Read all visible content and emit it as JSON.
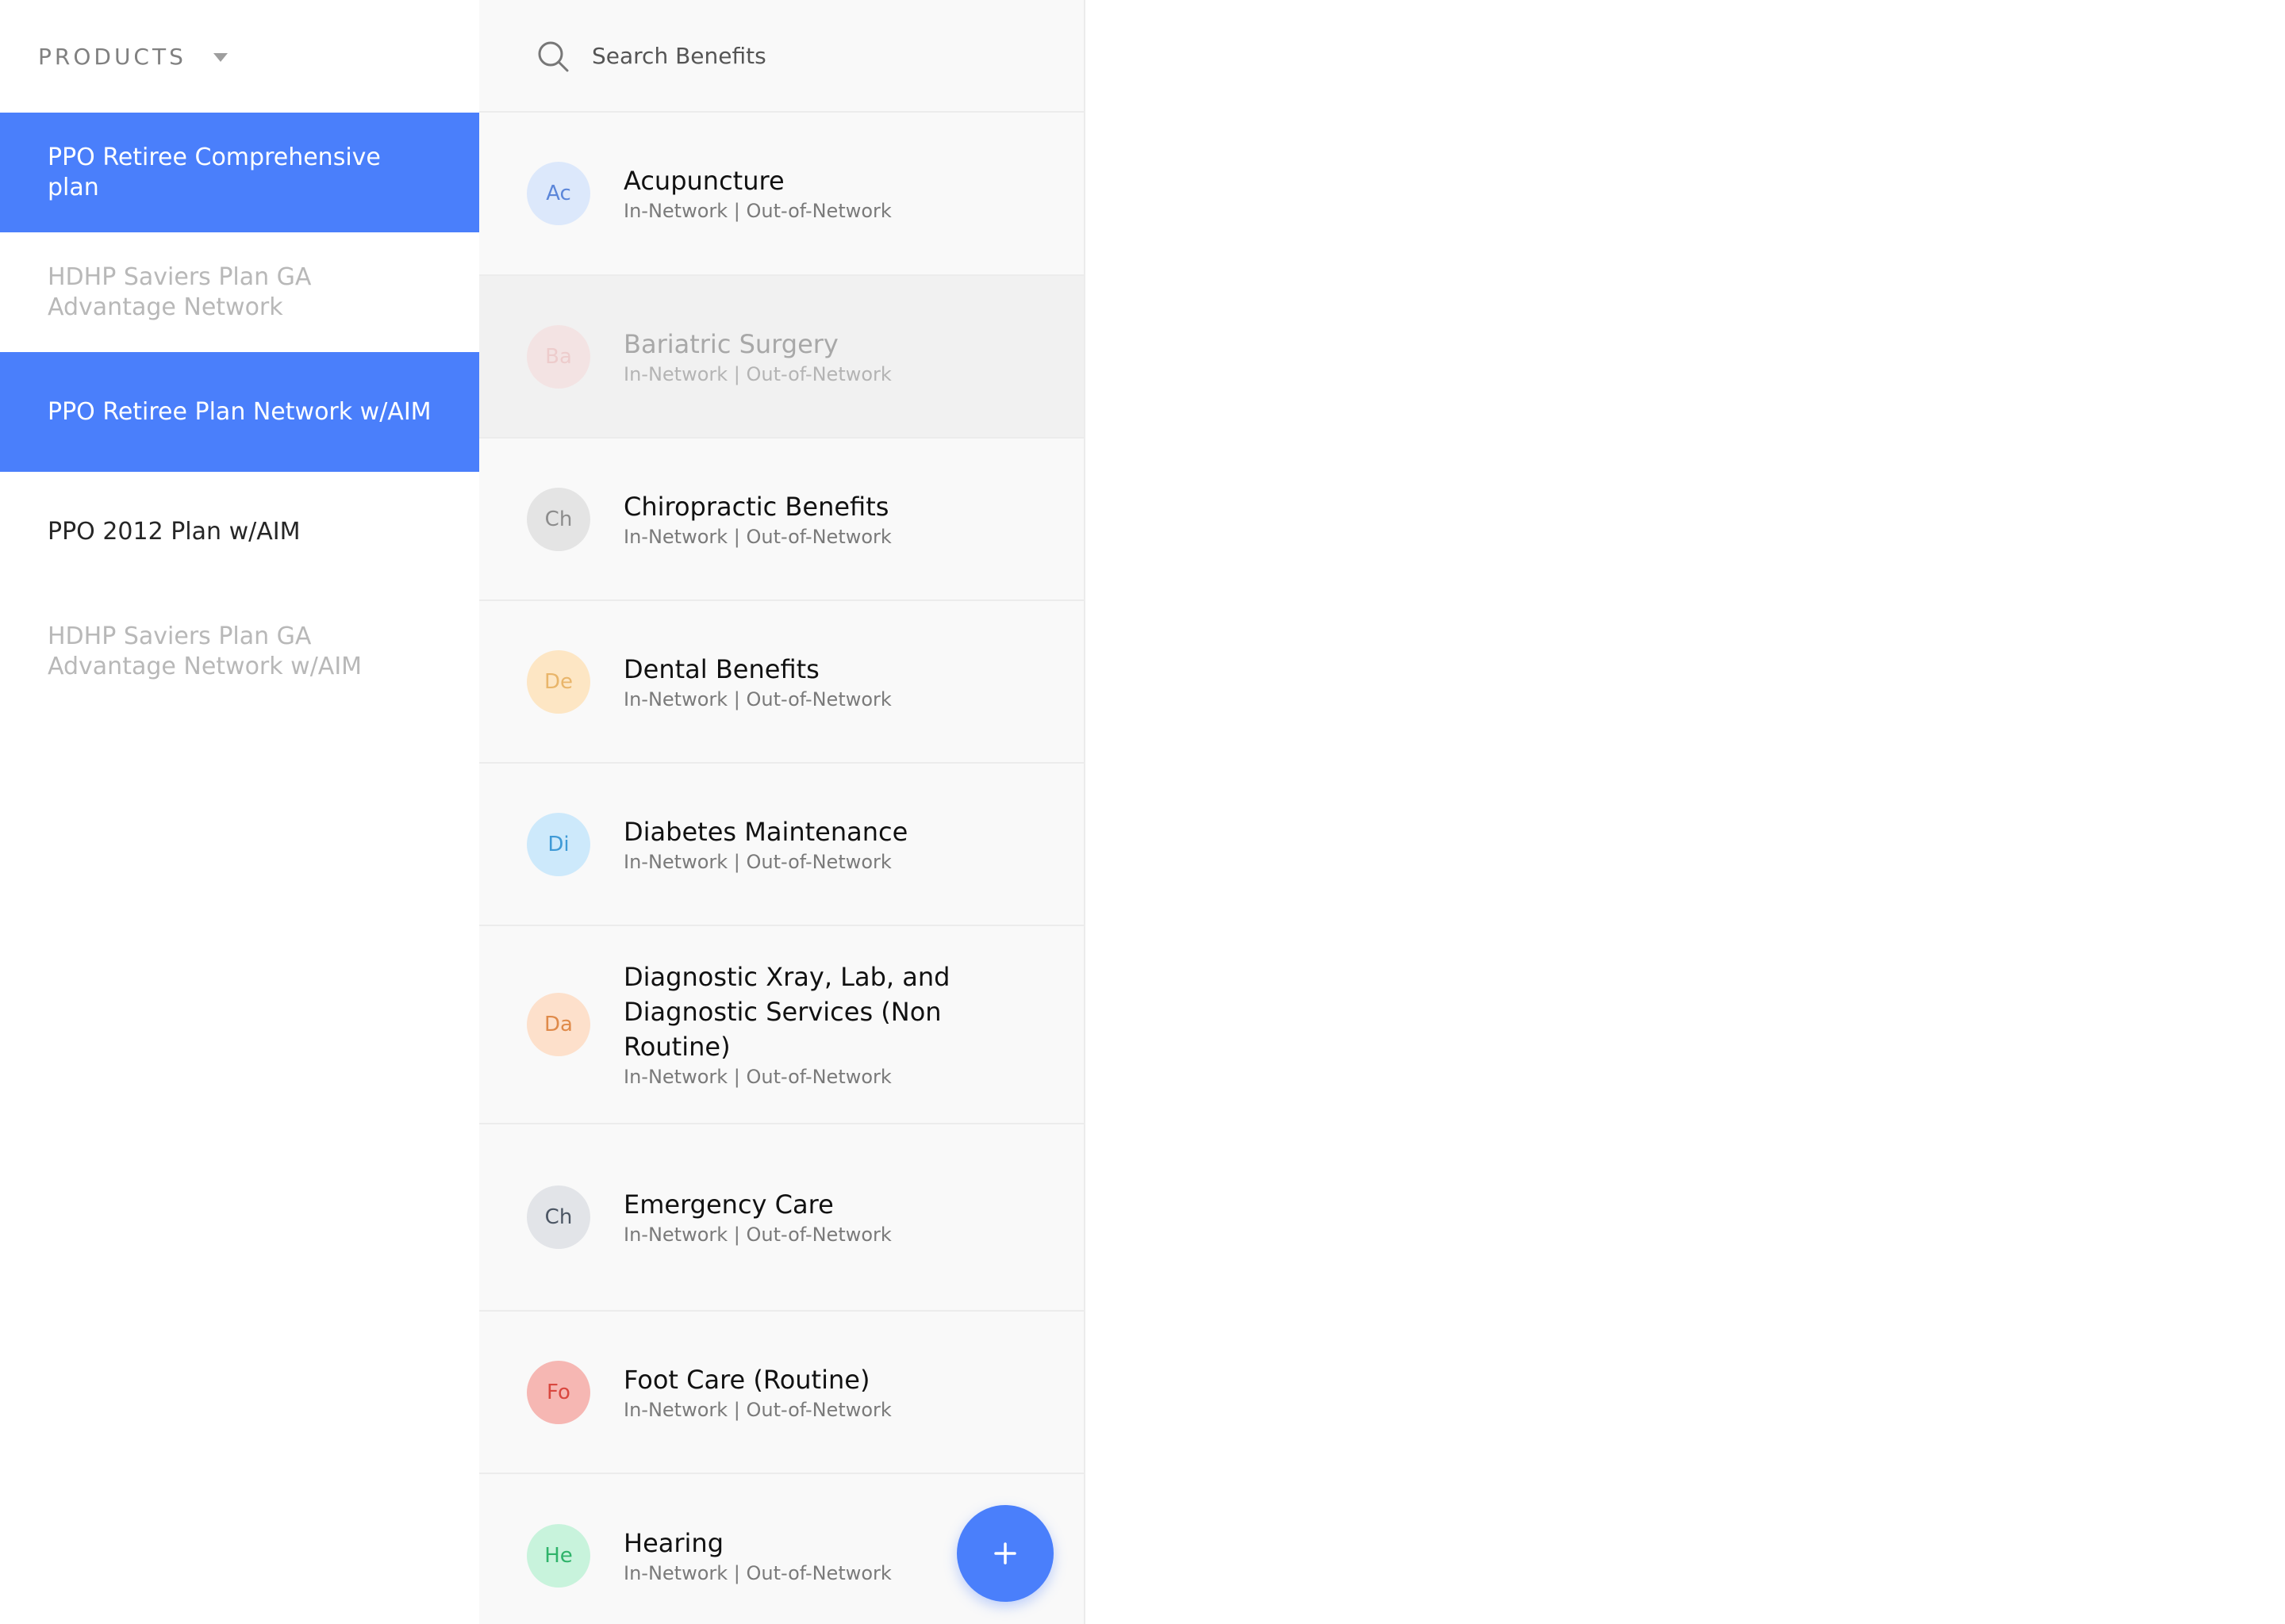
{
  "products": {
    "title": "PRODUCTS",
    "items": [
      {
        "label": "PPO Retiree Comprehensive plan",
        "state": "active"
      },
      {
        "label": "HDHP Saviers Plan GA Advantage Network",
        "state": "muted"
      },
      {
        "label": "PPO Retiree Plan Network w/AIM",
        "state": "active"
      },
      {
        "label": "PPO 2012 Plan w/AIM",
        "state": "normal"
      },
      {
        "label": "HDHP Saviers Plan GA Advantage Network w/AIM",
        "state": "muted"
      }
    ]
  },
  "search": {
    "placeholder": "Search Benefits",
    "value": ""
  },
  "benefits": [
    {
      "initials": "Ac",
      "title": "Acupuncture",
      "subtitle": "In-Network | Out-of-Network",
      "avatar_bg": "#dce8fb",
      "avatar_fg": "#5b86d9",
      "disabled": false
    },
    {
      "initials": "Ba",
      "title": "Bariatric Surgery",
      "subtitle": "In-Network | Out-of-Network",
      "avatar_bg": "#f7d4d4",
      "avatar_fg": "#e9a0a0",
      "disabled": true
    },
    {
      "initials": "Ch",
      "title": "Chiropractic Benefits",
      "subtitle": "In-Network | Out-of-Network",
      "avatar_bg": "#e4e4e4",
      "avatar_fg": "#8c8c8c",
      "disabled": false
    },
    {
      "initials": "De",
      "title": "Dental Benefits",
      "subtitle": "In-Network | Out-of-Network",
      "avatar_bg": "#fde6c4",
      "avatar_fg": "#e9b56a",
      "disabled": false
    },
    {
      "initials": "Di",
      "title": "Diabetes Maintenance",
      "subtitle": "In-Network | Out-of-Network",
      "avatar_bg": "#cde9fb",
      "avatar_fg": "#3f9ad6",
      "disabled": false
    },
    {
      "initials": "Da",
      "title": "Diagnostic Xray, Lab, and Diagnostic Services (Non Routine)",
      "subtitle": "In-Network | Out-of-Network",
      "avatar_bg": "#fde0cb",
      "avatar_fg": "#df8a4a",
      "disabled": false
    },
    {
      "initials": "Ch",
      "title": "Emergency Care",
      "subtitle": "In-Network | Out-of-Network",
      "avatar_bg": "#e2e4e8",
      "avatar_fg": "#4b5563",
      "disabled": false
    },
    {
      "initials": "Fo",
      "title": "Foot Care (Routine)",
      "subtitle": "In-Network | Out-of-Network",
      "avatar_bg": "#f6b7b3",
      "avatar_fg": "#d9473f",
      "disabled": false
    },
    {
      "initials": "He",
      "title": "Hearing",
      "subtitle": "In-Network | Out-of-Network",
      "avatar_bg": "#c8f3dc",
      "avatar_fg": "#2fb36a",
      "disabled": false
    }
  ],
  "add_button": {
    "icon": "plus-icon"
  },
  "colors": {
    "accent": "#4a7ffb",
    "panel_bg": "#f9f9f9",
    "divider": "#ececec"
  }
}
